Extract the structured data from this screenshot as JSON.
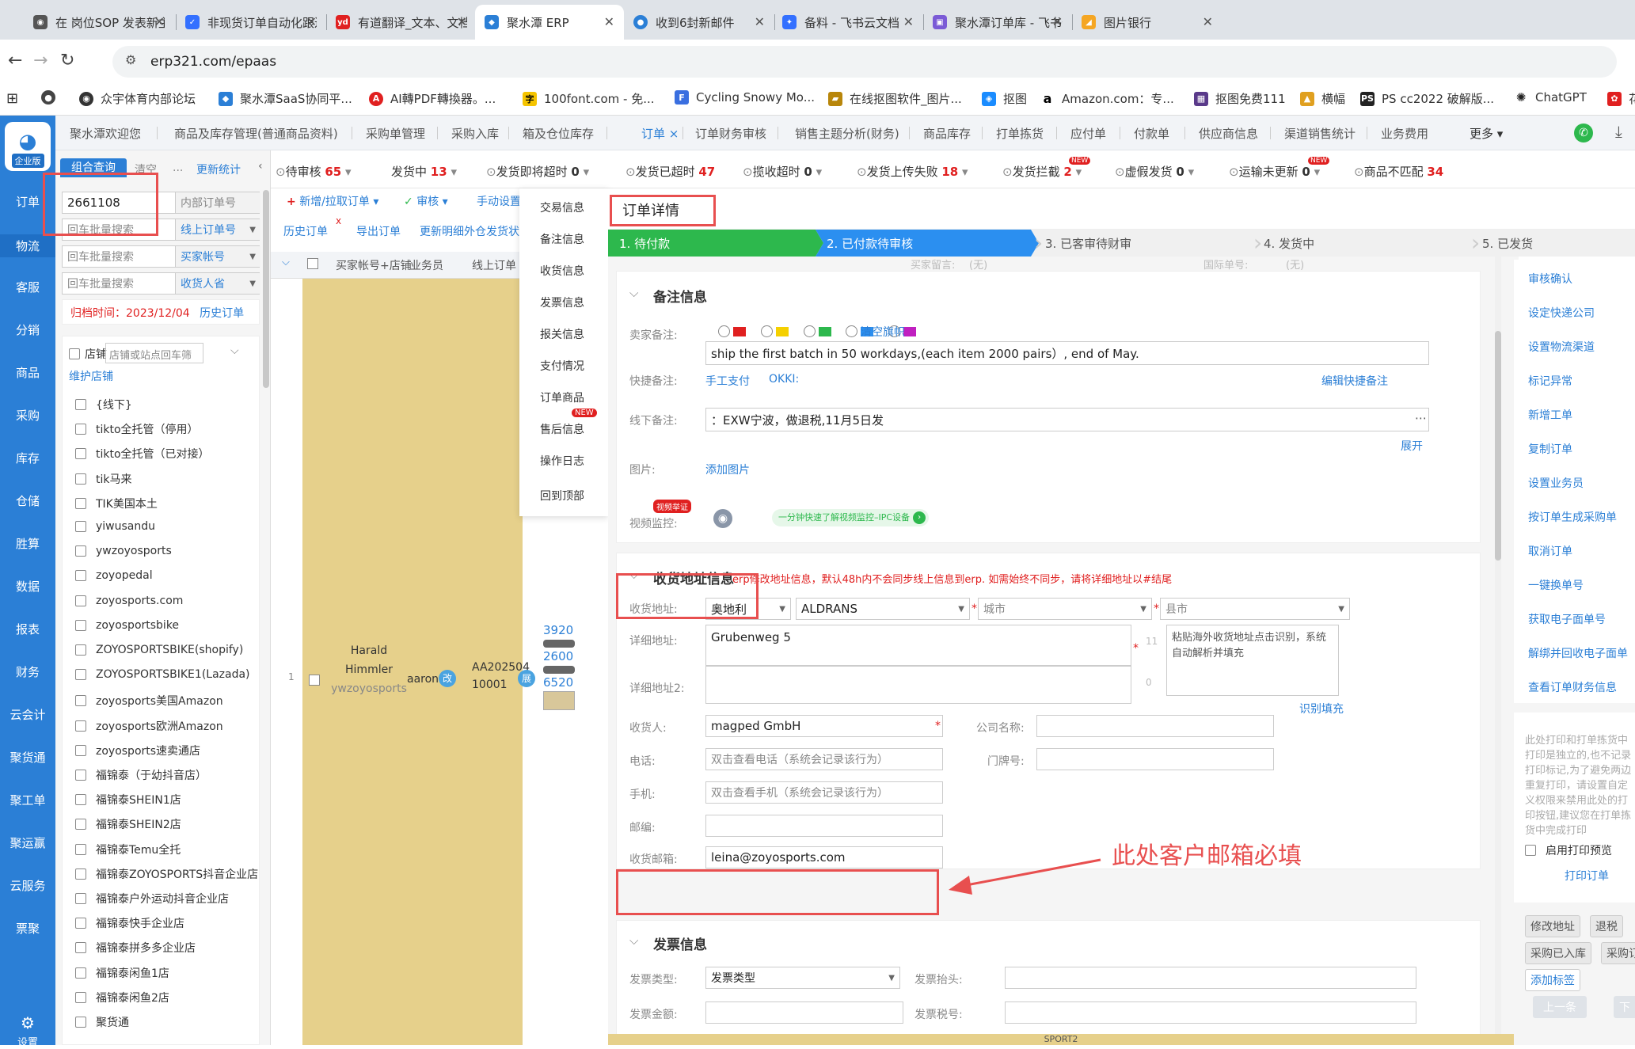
{
  "browser": {
    "tabs": [
      {
        "title": "在 岗位SOP 发表新主题",
        "icon": "discourse-icon",
        "color": "#555"
      },
      {
        "title": "非现货订单自动化跟进",
        "icon": "feishu-doc-icon",
        "color": "#3370ff"
      },
      {
        "title": "有道翻译_文本、文档、",
        "icon": "youdao-icon",
        "color": "#e02020"
      },
      {
        "title": "聚水潭 ERP",
        "icon": "jushuitan-icon",
        "color": "#2b7fd6"
      },
      {
        "title": "收到6封新邮件",
        "icon": "mail-pin-icon",
        "color": "#2b7fd6"
      },
      {
        "title": "备料 - 飞书云文档",
        "icon": "feishu-icon",
        "color": "#3370ff"
      },
      {
        "title": "聚水潭订单库 - 飞书云",
        "icon": "feishu-base-icon",
        "color": "#7b5bd6"
      },
      {
        "title": "图片银行",
        "icon": "alibaba-icon",
        "color": "#f5a623"
      }
    ],
    "url": "erp321.com/epaas",
    "bookmarks": [
      "众宇体育内部论坛",
      "聚水潭SaaS协同平...",
      "AI轉PDF轉換器。...",
      "100font.com - 免...",
      "Cycling Snowy Mo...",
      "在线抠图软件_图片...",
      "抠图",
      "Amazon.com：专...",
      "抠图免费111",
      "横幅",
      "PS cc2022 破解版...",
      "ChatGPT",
      "花"
    ]
  },
  "leftnav": {
    "badge": "企业版",
    "items": [
      "订单",
      "物流",
      "客服",
      "分销",
      "商品",
      "采购",
      "库存",
      "仓储",
      "胜算",
      "数据",
      "报表",
      "财务",
      "云会计",
      "聚货通",
      "聚工单",
      "聚运赢",
      "云服务",
      "票聚"
    ],
    "settings": "设置"
  },
  "topmenu": {
    "items": [
      "聚水潭欢迎您",
      "商品及库存管理(普通商品资料)",
      "采购单管理",
      "采购入库",
      "箱及仓位库存",
      "订单 ×",
      "订单财务审核",
      "销售主题分析(财务)",
      "商品库存",
      "打单拣货",
      "应付单",
      "付款单",
      "供应商信息",
      "渠道销售统计",
      "业务费用",
      "更多 ▾"
    ]
  },
  "status": [
    {
      "label": "待审核",
      "count": "65"
    },
    {
      "label": "发货中",
      "count": "13"
    },
    {
      "label": "发货即将超时",
      "count": "0"
    },
    {
      "label": "发货已超时",
      "count": "47"
    },
    {
      "label": "揽收超时",
      "count": "0"
    },
    {
      "label": "发货上传失败",
      "count": "18"
    },
    {
      "label": "发货拦截",
      "count": "2"
    },
    {
      "label": "虚假发货",
      "count": "0"
    },
    {
      "label": "运输未更新",
      "count": "0"
    },
    {
      "label": "商品不匹配",
      "count": "34"
    }
  ],
  "filter": {
    "tab1": "组合查询",
    "tab2": "清空",
    "stats": "更新统计",
    "order_no": "2661108",
    "order_no_type": "内部订单号",
    "rows": [
      {
        "ph": "回车批量搜索",
        "sel": "线上订单号"
      },
      {
        "ph": "回车批量搜索",
        "sel": "买家帐号"
      },
      {
        "ph": "回车批量搜索",
        "sel": "收货人省"
      }
    ],
    "archive_label": "归档时间：",
    "archive_date": "2023/12/04",
    "history": "历史订单",
    "shop_label": "店铺",
    "shop_ph": "店铺或站点回车筛",
    "maintain": "维护店铺",
    "shops": [
      "{线下}",
      "tikto全托管（停用）",
      "tikto全托管（已对接）",
      "tik马来",
      "TIK美国本土",
      "yiwusandu",
      "ywzoyosports",
      "zoyopedal",
      "zoyosports.com",
      "zoyosportsbike",
      "ZOYOSPORTSBIKE(shopify)",
      "ZOYOSPORTSBIKE1(Lazada)",
      "zoyosports美国Amazon",
      "zoyosports欧洲Amazon",
      "zoyosports速卖通店",
      "福锦泰（于幼抖音店）",
      "福锦泰SHEIN1店",
      "福锦泰SHEIN2店",
      "福锦泰Temu全托",
      "福锦泰ZOYOSPORTS抖音企业店",
      "福锦泰户外运动抖音企业店",
      "福锦泰快手企业店",
      "福锦泰拼多多企业店",
      "福锦泰闲鱼1店",
      "福锦泰闲鱼2店",
      "聚货通"
    ]
  },
  "toolbar": {
    "new": "新增/拉取订单 ▾",
    "audit": "审核 ▾",
    "manual": "手动设置",
    "history": "历史订单",
    "export": "导出订单",
    "update": "更新明细外仓发货状"
  },
  "table": {
    "headers": [
      "买家帐号+店铺",
      "业务员",
      "线上订单"
    ],
    "row": {
      "buyer": "Harald Himmler",
      "shop": "ywzoyosports",
      "salesman": "aaron",
      "edit": "改",
      "online_no": "AA20250410001",
      "price_tag": "展",
      "qtys": [
        "3920",
        "2600",
        "6520"
      ],
      "footer": "SPORT2"
    }
  },
  "detail_tabs": [
    "交易信息",
    "备注信息",
    "收货信息",
    "发票信息",
    "报关信息",
    "支付情况",
    "订单商品",
    "售后信息",
    "操作日志",
    "回到顶部"
  ],
  "detail": {
    "title": "订单详情",
    "steps": [
      "1. 待付款",
      "2. 已付款待审核",
      "3. 已客审待财审",
      "4. 发货中",
      "5. 已发货"
    ],
    "remark": {
      "title": "备注信息",
      "seller_label": "卖家备注:",
      "clear_flag": "清空旗帜",
      "seller_note": "ship the first batch in 50 workdays,(each item 2000 pairs）, end of May.",
      "quick_label": "快捷备注:",
      "quick1": "手工支付",
      "quick2": "OKKI:",
      "edit_quick": "编辑快捷备注",
      "offline_label": "线下备注:",
      "offline_note": "：EXW宁波，做退税,11月5日发",
      "expand": "展开",
      "image_label": "图片:",
      "add_image": "添加图片",
      "video_label": "视频监控:",
      "video_badge": "视频举证",
      "video_tip": "一分钟快速了解视频监控–IPC设备"
    },
    "address": {
      "title": "收货地址信息",
      "warning": "erp修改地址信息，默认48h内不会同步线上信息到erp. 如需始终不同步，请将详细地址以#结尾",
      "addr_label": "收货地址:",
      "country": "奥地利",
      "province": "ALDRANS",
      "city_ph": "城市",
      "county_ph": "县市",
      "detail_label": "详细地址:",
      "detail": "Grubenweg 5",
      "detail_count": "11",
      "paste_tip": "粘贴海外收货地址点击识别，系统自动解析并填充",
      "detail2_label": "详细地址2:",
      "detail2_count": "0",
      "recognize": "识别填充",
      "receiver_label": "收货人:",
      "receiver": "magped GmbH",
      "company_label": "公司名称:",
      "phone_label": "电话:",
      "phone_ph": "双击查看电话（系统会记录该行为）",
      "door_label": "门牌号:",
      "mobile_label": "手机:",
      "mobile_ph": "双击查看手机（系统会记录该行为）",
      "zip_label": "邮编:",
      "email_label": "收货邮箱:",
      "email": "leina@zoyosports.com"
    },
    "invoice": {
      "title": "发票信息",
      "type_label": "发票类型:",
      "type": "发票类型",
      "head_label": "发票抬头:",
      "amount_label": "发票金额:",
      "tax_label": "发票税号:"
    },
    "partial_top": {
      "l1": "买家留言:",
      "v1": "(无)",
      "l2": "国际单号:",
      "v2": "(无)"
    }
  },
  "right": {
    "actions": [
      "审核确认",
      "设定快递公司",
      "设置物流渠道",
      "标记异常",
      "新增工单",
      "复制订单",
      "设置业务员",
      "按订单生成采购单",
      "取消订单",
      "一键换单号",
      "获取电子面单号",
      "解绑并回收电子面单",
      "查看订单财务信息"
    ],
    "print_tip": "此处打印和打单拣货中打印是独立的,也不记录打印标记,为了避免两边重复打印，请设置自定义权限来禁用此处的打印按钮,建议您在打单拣货中完成打印",
    "preview": "启用打印预览",
    "print": "打印订单",
    "buttons": [
      "修改地址",
      "退税",
      "采购已入库",
      "采购订",
      "添加标签"
    ],
    "prev": "上一条",
    "next": "下"
  },
  "annotation": {
    "text": "此处客户邮箱必填",
    "color": "#e84f4f"
  }
}
